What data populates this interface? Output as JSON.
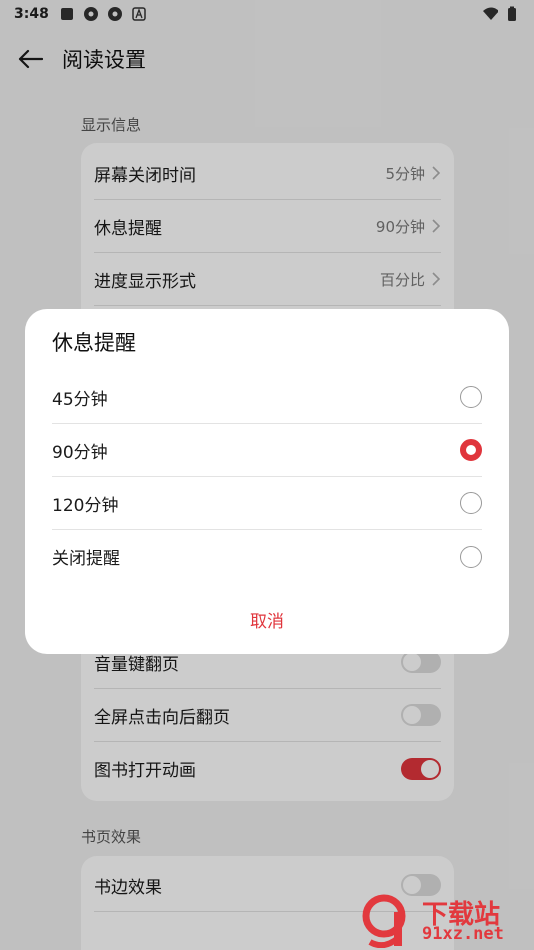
{
  "status_bar": {
    "time": "3:48"
  },
  "header": {
    "title": "阅读设置"
  },
  "sections": {
    "display": {
      "title": "显示信息",
      "rows": [
        {
          "label": "屏幕关闭时间",
          "value": "5分钟"
        },
        {
          "label": "休息提醒",
          "value": "90分钟"
        },
        {
          "label": "进度显示形式",
          "value": "百分比"
        }
      ]
    },
    "paging": {
      "rows": [
        {
          "label": "音量键翻页",
          "toggle": false
        },
        {
          "label": "全屏点击向后翻页",
          "toggle": false
        },
        {
          "label": "图书打开动画",
          "toggle": true
        }
      ]
    },
    "page_effect": {
      "title": "书页效果",
      "rows": [
        {
          "label": "书边效果",
          "toggle": false
        }
      ]
    }
  },
  "dialog": {
    "title": "休息提醒",
    "options": [
      {
        "label": "45分钟",
        "checked": false
      },
      {
        "label": "90分钟",
        "checked": true
      },
      {
        "label": "120分钟",
        "checked": false
      },
      {
        "label": "关闭提醒",
        "checked": false
      }
    ],
    "cancel_label": "取消"
  },
  "watermark": {
    "line1": "下载站",
    "line2": "91xz.net"
  },
  "colors": {
    "accent": "#e0353c",
    "background": "#f1f1f1",
    "card": "#ffffff"
  }
}
